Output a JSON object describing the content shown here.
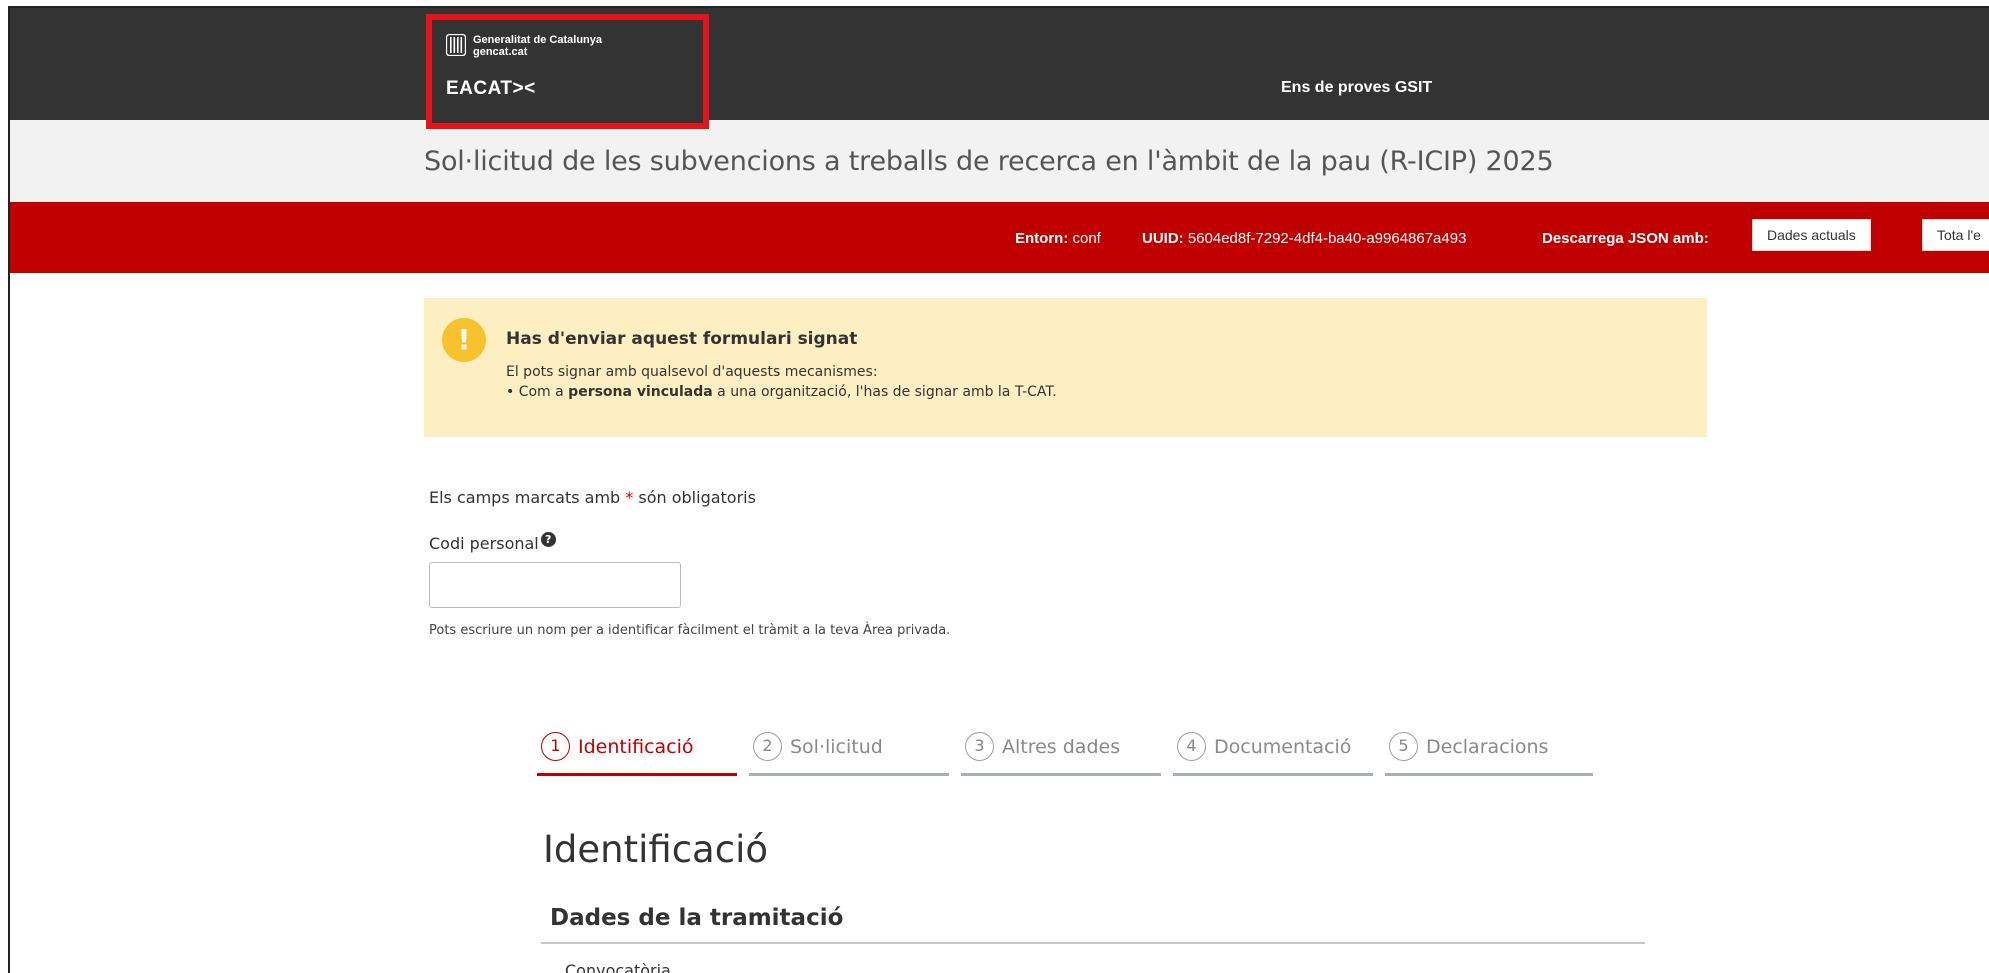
{
  "header": {
    "org_line1": "Generalitat de Catalunya",
    "org_line2": "gencat.cat",
    "app_logo": "EACAT><",
    "entity": "Ens de proves GSIT"
  },
  "page": {
    "title": "Sol·licitud de les subvencions a treballs de recerca en l'àmbit de la pau (R-ICIP) 2025"
  },
  "envbar": {
    "env_label": "Entorn:",
    "env_value": "conf",
    "uuid_label": "UUID:",
    "uuid_value": "5604ed8f-7292-4df4-ba40-a9964867a493",
    "download_label": "Descarrega JSON amb:",
    "btn_current": "Dades actuals",
    "btn_all": "Tota l'e"
  },
  "alert": {
    "icon": "warning-icon",
    "title": "Has d'enviar aquest formulari signat",
    "line1": "El pots signar amb qualsevol d'aquests mecanismes:",
    "bullet_prefix": "• Com a ",
    "bullet_bold": "persona vinculada",
    "bullet_suffix": " a una organització, l'has de signar amb la T-CAT.",
    "color": "#fdefc2"
  },
  "form": {
    "required_note_prefix": "Els camps marcats amb ",
    "required_star": "*",
    "required_note_suffix": " són obligatoris",
    "code_label": "Codi personal",
    "code_value": "",
    "code_hint": "Pots escriure un nom per a identificar fàcilment el tràmit a la teva Àrea privada."
  },
  "steps": [
    {
      "num": "1",
      "label": "Identificació",
      "active": true
    },
    {
      "num": "2",
      "label": "Sol·licitud",
      "active": false
    },
    {
      "num": "3",
      "label": "Altres dades",
      "active": false
    },
    {
      "num": "4",
      "label": "Documentació",
      "active": false
    },
    {
      "num": "5",
      "label": "Declaracions",
      "active": false
    }
  ],
  "section": {
    "title": "Identificació",
    "subtitle": "Dades de la tramitació",
    "first_field": "Convocatòria"
  },
  "colors": {
    "topbar": "#333333",
    "accent_red": "#c00000",
    "highlight_border": "#e5141a"
  }
}
